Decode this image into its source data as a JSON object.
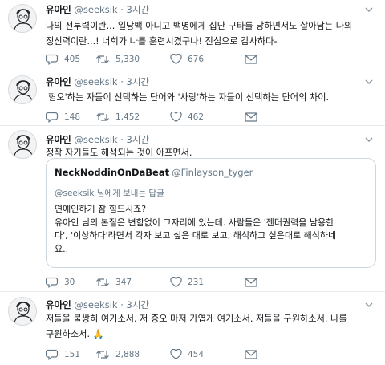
{
  "tweets": [
    {
      "author": {
        "name": "유아인",
        "handle": "@seeksik",
        "time": "3시간"
      },
      "text_lines": [
        "나의 전투력이란... 일당백 아니고 백명에게 집단 구타를 당하면서도 살아남는 나의",
        "정신력이란...! 너희가 나를 훈련시켰구나! 진심으로 감사하다-"
      ],
      "stats": {
        "replies": "405",
        "retweets": "5,330",
        "likes": "676"
      }
    },
    {
      "author": {
        "name": "유아인",
        "handle": "@seeksik",
        "time": "3시간"
      },
      "text_lines": [
        "'혐오'하는 자들이 선택하는 단어와 '사랑'하는 자들이 선택하는 단어의 차이."
      ],
      "stats": {
        "replies": "148",
        "retweets": "1,452",
        "likes": "462"
      }
    },
    {
      "author": {
        "name": "유아인",
        "handle": "@seeksik",
        "time": "3시간"
      },
      "text_lines": [
        "정작 자기들도 해석되는 것이 아프면서."
      ],
      "quote": {
        "name": "NeckNoddinOnDaBeat",
        "handle": "@Finlayson_tyger",
        "reply_to": "@seeksik 님에게 보내는 답글",
        "text_lines": [
          "연예인하기 참 힘드시죠?",
          "유아인 님의 본질은 변함없이 그자리에 있는데. 사람들은 '젠더권력을 남용한",
          "다', '이상하다'라면서 각자 보고 싶은 대로 보고, 해석하고 싶은대로 해석하네",
          "요.."
        ]
      },
      "stats": {
        "replies": "30",
        "retweets": "347",
        "likes": "231"
      }
    },
    {
      "author": {
        "name": "유아인",
        "handle": "@seeksik",
        "time": "3시간"
      },
      "text_lines": [
        "저들을 불쌍히 여기소서. 저 증오 마저 가엽게 여기소서. 저들을 구원하소서. 나를",
        "구원하소서. 🙏"
      ],
      "stats": {
        "replies": "151",
        "retweets": "2,888",
        "likes": "454"
      }
    }
  ],
  "icons": {
    "avatar": "avatar-line-portrait",
    "menu": "chevron-down-icon",
    "reply": "reply-icon",
    "retweet": "retweet-icon",
    "like": "heart-icon",
    "message": "envelope-icon"
  },
  "colors": {
    "text": "#14171a",
    "muted": "#657786",
    "divider": "#e6ecf0",
    "border": "#ccd6dd"
  }
}
